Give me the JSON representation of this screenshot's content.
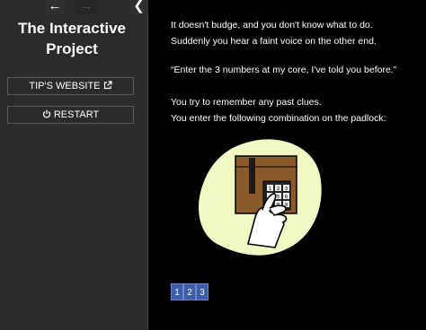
{
  "sidebar": {
    "title_line1": "The Interactive",
    "title_line2": "Project",
    "website_label": "TIP'S WEBSITE",
    "restart_label": "RESTART",
    "nav_back_icon": "arrow-left-icon",
    "nav_forward_icon": "arrow-right-icon",
    "collapse_icon": "chevron-left-icon"
  },
  "story": {
    "line1": "It doesn't budge, and you don't know what to do.",
    "line2": "Suddenly you hear a faint voice on the other end.",
    "line3": "“Enter the 3 numbers at my core, I've told you before.”",
    "line4": "You try to remember any past clues.",
    "line5": "You enter the following combination on the padlock:"
  },
  "keypad_digits": [
    "1",
    "2",
    "3",
    "4",
    "5",
    "6",
    "7",
    "8",
    "9"
  ],
  "combination": [
    "1",
    "2",
    "3"
  ],
  "colors": {
    "accent": "#3d5ca9",
    "blob": "#f2f8c4",
    "box": "#8b5a2b"
  }
}
